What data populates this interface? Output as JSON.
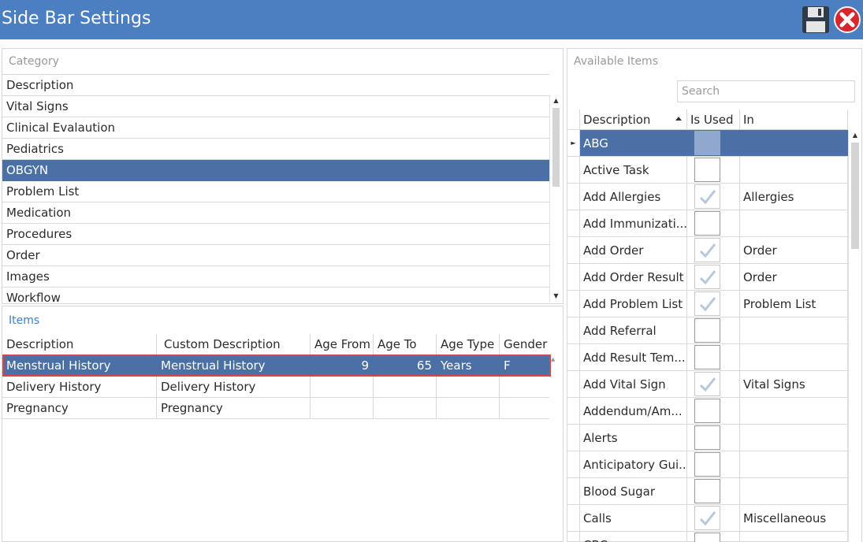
{
  "window": {
    "title": "Side Bar Settings"
  },
  "category": {
    "label": "Category",
    "header": "Description",
    "items": [
      "Vital Signs",
      "Clinical Evalaution",
      "Pediatrics",
      "OBGYN",
      "Problem List",
      "Medication",
      "Procedures",
      "Order",
      "Images",
      "Workflow"
    ],
    "selected": "OBGYN"
  },
  "items": {
    "label": "Items",
    "columns": [
      "Description",
      "Custom Description",
      "Age From",
      "Age To",
      "Age Type",
      "Gender"
    ],
    "rows": [
      {
        "description": "Menstrual History",
        "custom": "Menstrual History",
        "age_from": "9",
        "age_to": "65",
        "age_type": "Years",
        "gender": "F"
      },
      {
        "description": "Delivery History",
        "custom": "Delivery History",
        "age_from": "",
        "age_to": "",
        "age_type": "",
        "gender": ""
      },
      {
        "description": "Pregnancy",
        "custom": "Pregnancy",
        "age_from": "",
        "age_to": "",
        "age_type": "",
        "gender": ""
      }
    ]
  },
  "available": {
    "label": "Available Items",
    "search_placeholder": "Search",
    "columns": [
      "Description",
      "Is Used",
      "In"
    ],
    "rows": [
      {
        "description": "ABG",
        "used": false,
        "in": ""
      },
      {
        "description": "Active Task",
        "used": false,
        "in": ""
      },
      {
        "description": "Add Allergies",
        "used": true,
        "in": "Allergies"
      },
      {
        "description": "Add Immunizati...",
        "used": false,
        "in": ""
      },
      {
        "description": "Add Order",
        "used": true,
        "in": "Order"
      },
      {
        "description": "Add Order Result",
        "used": true,
        "in": "Order"
      },
      {
        "description": "Add Problem List",
        "used": true,
        "in": "Problem List"
      },
      {
        "description": "Add Referral",
        "used": false,
        "in": ""
      },
      {
        "description": "Add Result Tem...",
        "used": false,
        "in": ""
      },
      {
        "description": "Add Vital Sign",
        "used": true,
        "in": "Vital Signs"
      },
      {
        "description": "Addendum/Am...",
        "used": false,
        "in": ""
      },
      {
        "description": "Alerts",
        "used": false,
        "in": ""
      },
      {
        "description": "Anticipatory Gui...",
        "used": false,
        "in": ""
      },
      {
        "description": "Blood Sugar",
        "used": false,
        "in": ""
      },
      {
        "description": "Calls",
        "used": true,
        "in": "Miscellaneous"
      },
      {
        "description": "CBC",
        "used": false,
        "in": ""
      }
    ]
  },
  "colors": {
    "titlebar": "#4a7fc1",
    "selection": "#4a70a5",
    "highlight": "#d9434a"
  }
}
